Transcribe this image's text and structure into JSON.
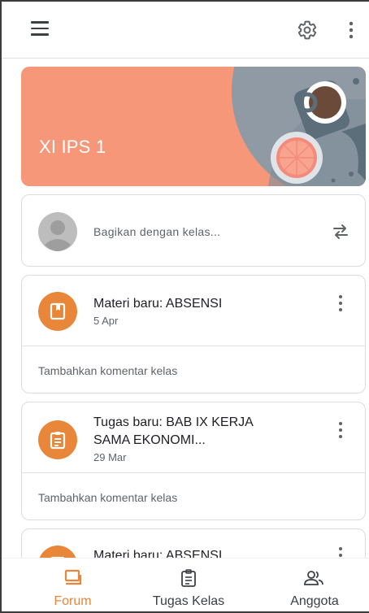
{
  "app": {
    "icons": {
      "menu": "menu-icon",
      "settings": "gear-icon",
      "more": "more-vert-icon"
    }
  },
  "banner": {
    "class_name": "XI IPS 1",
    "color": "#f7977a"
  },
  "share": {
    "placeholder": "Bagikan dengan kelas...",
    "icons": {
      "avatar": "avatar-icon",
      "repost": "repost-icon"
    }
  },
  "posts": [
    {
      "title_line1": "Materi baru: ABSENSI",
      "title_line2": "",
      "date": "5 Apr",
      "comment_prompt": "Tambahkan komentar kelas",
      "icon": "book-icon"
    },
    {
      "title_line1": "Tugas baru: BAB IX KERJA",
      "title_line2": "SAMA EKONOMI...",
      "date": "29 Mar",
      "comment_prompt": "Tambahkan komentar kelas",
      "icon": "assignment-icon"
    },
    {
      "title_line1": "Materi baru: ABSENSI",
      "title_line2": "",
      "date": "",
      "comment_prompt": "",
      "icon": "book-icon"
    }
  ],
  "bottom_nav": {
    "items": [
      {
        "label": "Forum",
        "icon": "forum-icon",
        "active": true
      },
      {
        "label": "Tugas Kelas",
        "icon": "classwork-icon",
        "active": false
      },
      {
        "label": "Anggota",
        "icon": "people-icon",
        "active": false
      }
    ],
    "accent": "#e8863a"
  }
}
